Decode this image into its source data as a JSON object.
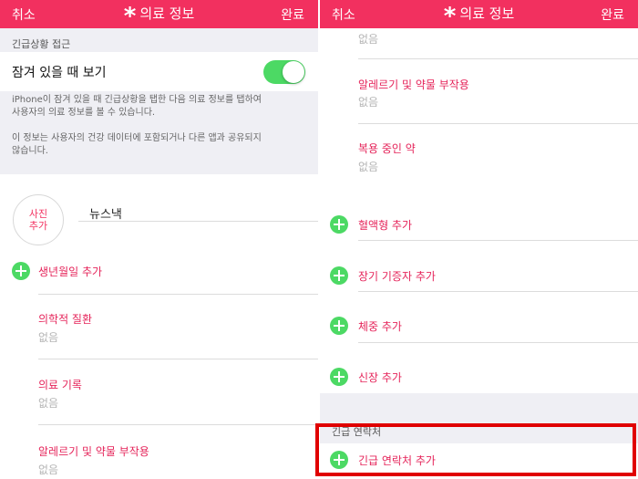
{
  "left": {
    "nav": {
      "cancel": "취소",
      "star": "*",
      "title": "의료 정보",
      "done": "완료"
    },
    "emergency_section": {
      "header": "긴급상황 접근",
      "lock_label": "잠겨 있을 때 보기",
      "toggle_on": true,
      "desc1_line1": "iPhone이 잠겨 있을 때 긴급상황을 탭한 다음 의료 정보를 탭하여",
      "desc1_line2": "사용자의 의료 정보를 볼 수 있습니다.",
      "desc2_line1": "이 정보는 사용자의 건강 데이터에 포함되거나 다른 앱과 공유되지",
      "desc2_line2": "않습니다."
    },
    "profile": {
      "photo_line1": "사진",
      "photo_line2": "추가",
      "name": "뉴스낵"
    },
    "add_birthday": "생년월일 추가",
    "fields": [
      {
        "label": "의학적 질환",
        "value": "없음"
      },
      {
        "label": "의료 기록",
        "value": "없음"
      },
      {
        "label": "알레르기 및 약물 부작용",
        "value": "없음"
      }
    ]
  },
  "right": {
    "nav": {
      "cancel": "취소",
      "star": "*",
      "title": "의료 정보",
      "done": "완료"
    },
    "top_value": "없음",
    "fields": [
      {
        "label": "알레르기 및 약물 부작용",
        "value": "없음"
      },
      {
        "label": "복용 중인 약",
        "value": "없음"
      }
    ],
    "add_rows": [
      {
        "label": "혈액형 추가"
      },
      {
        "label": "장기 기증자 추가"
      },
      {
        "label": "체중 추가"
      },
      {
        "label": "신장 추가"
      }
    ],
    "contact_section": {
      "header": "긴급 연락처",
      "add_label": "긴급 연락처 추가"
    }
  },
  "colors": {
    "accent": "#f2305f",
    "toggle_green": "#4cd964",
    "highlight": "#e00000"
  }
}
